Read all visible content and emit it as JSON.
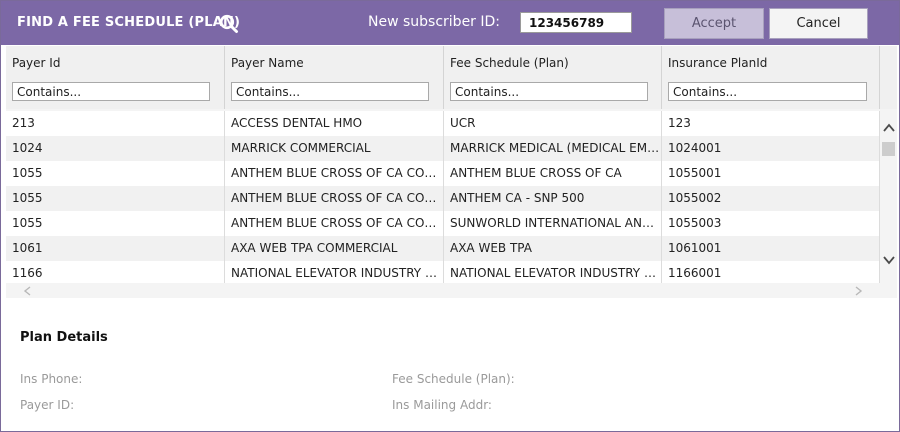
{
  "header": {
    "title": "FIND A FEE SCHEDULE (PLAN)",
    "subscriber_label": "New subscriber ID:",
    "subscriber_value": "123456789",
    "accept_label": "Accept",
    "cancel_label": "Cancel",
    "search_icon": "search-icon"
  },
  "grid": {
    "columns": [
      {
        "label": "Payer Id",
        "filter_placeholder": "Contains..."
      },
      {
        "label": "Payer Name",
        "filter_placeholder": "Contains..."
      },
      {
        "label": "Fee Schedule (Plan)",
        "filter_placeholder": "Contains..."
      },
      {
        "label": "Insurance PlanId",
        "filter_placeholder": "Contains..."
      }
    ],
    "rows": [
      [
        "213",
        "ACCESS DENTAL HMO",
        "UCR",
        "123"
      ],
      [
        "1024",
        "MARRICK COMMERCIAL",
        "MARRICK MEDICAL (MEDICAL EMPLOYEES)",
        "1024001"
      ],
      [
        "1055",
        "ANTHEM BLUE CROSS OF CA COMMERCIAL",
        "ANTHEM BLUE CROSS OF CA",
        "1055001"
      ],
      [
        "1055",
        "ANTHEM BLUE CROSS OF CA COMMERCIAL",
        "ANTHEM CA - SNP 500",
        "1055002"
      ],
      [
        "1055",
        "ANTHEM BLUE CROSS OF CA COMMERCIAL",
        "SUNWORLD INTERNATIONAL ANTHEM",
        "1055003"
      ],
      [
        "1061",
        "AXA WEB TPA COMMERCIAL",
        "AXA WEB TPA",
        "1061001"
      ],
      [
        "1166",
        "NATIONAL ELEVATOR INDUSTRY BENEFIT PLAN",
        "NATIONAL ELEVATOR INDUSTRY BENEFIT PLAN",
        "1166001"
      ]
    ],
    "scroll_icons": {
      "up": "chevron-up-icon",
      "down": "chevron-down-icon",
      "left": "chevron-left-icon",
      "right": "chevron-right-icon"
    }
  },
  "details": {
    "title": "Plan Details",
    "ins_phone_label": "Ins Phone:",
    "payer_id_label": "Payer ID:",
    "fee_schedule_label": "Fee Schedule (Plan):",
    "mailing_addr_label": "Ins Mailing Addr:"
  },
  "colors": {
    "header_bg": "#7c68a6",
    "accept_bg": "#c7bfd9",
    "row_alt": "#f1f1f1"
  }
}
